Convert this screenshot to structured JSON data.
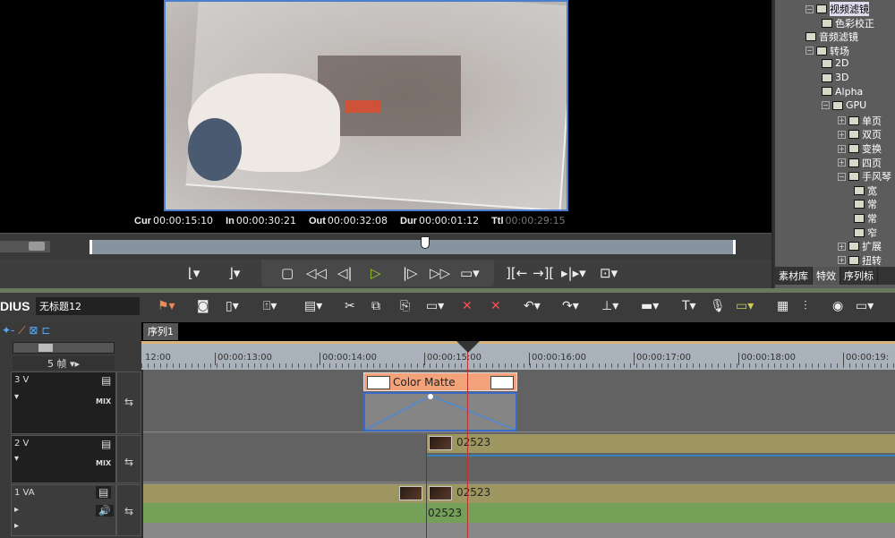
{
  "preview": {
    "timecodes": [
      {
        "label": "Cur",
        "value": "00:00:15:10"
      },
      {
        "label": "In",
        "value": "00:00:30:21"
      },
      {
        "label": "Out",
        "value": "00:00:32:08"
      },
      {
        "label": "Dur",
        "value": "00:00:01:12"
      },
      {
        "label": "Ttl",
        "value": "00:00:29:15"
      }
    ],
    "scrub_position": 0.52
  },
  "effects_tree": [
    {
      "label": "视频滤镜",
      "level": 1,
      "type": "folder",
      "selected": true
    },
    {
      "label": "色彩校正",
      "level": 2,
      "type": "item"
    },
    {
      "label": "音频滤镜",
      "level": 1,
      "type": "item"
    },
    {
      "label": "转场",
      "level": 1,
      "type": "folder"
    },
    {
      "label": "2D",
      "level": 2,
      "type": "item"
    },
    {
      "label": "3D",
      "level": 2,
      "type": "item"
    },
    {
      "label": "Alpha",
      "level": 2,
      "type": "item"
    },
    {
      "label": "GPU",
      "level": 2,
      "type": "folder"
    },
    {
      "label": "单页",
      "level": 3,
      "type": "item"
    },
    {
      "label": "双页",
      "level": 3,
      "type": "item"
    },
    {
      "label": "变换",
      "level": 3,
      "type": "item"
    },
    {
      "label": "四页",
      "level": 3,
      "type": "item"
    },
    {
      "label": "手风琴",
      "level": 3,
      "type": "folder"
    },
    {
      "label": "宽",
      "level": 4,
      "type": "item"
    },
    {
      "label": "常",
      "level": 4,
      "type": "item"
    },
    {
      "label": "常",
      "level": 4,
      "type": "item"
    },
    {
      "label": "窄",
      "level": 4,
      "type": "item"
    },
    {
      "label": "扩展",
      "level": 3,
      "type": "item"
    },
    {
      "label": "扭转",
      "level": 3,
      "type": "item"
    }
  ],
  "panel_tabs": [
    "素材库",
    "特效",
    "序列标"
  ],
  "app": {
    "name": "DIUS",
    "project": "无标题12"
  },
  "sequence_tab": "序列1",
  "ruler": [
    "12:00",
    "00:00:13:00",
    "00:00:14:00",
    "00:00:15:00",
    "00:00:16:00",
    "00:00:17:00",
    "00:00:18:00",
    "00:00:19:"
  ],
  "zoom_label": "5 帧",
  "tracks": [
    {
      "name": "3 V",
      "mix": "MIX"
    },
    {
      "name": "2 V",
      "mix": "MIX"
    },
    {
      "name": "1 VA"
    }
  ],
  "clips": {
    "color_matte": "Color Matte",
    "video2": "02523",
    "video1": "02523",
    "audio1": "02523"
  },
  "colors": {
    "matte": "#f4a27a",
    "video_clip": "#9e9660",
    "audio_clip": "#74a058",
    "playhead": "#c03030"
  }
}
